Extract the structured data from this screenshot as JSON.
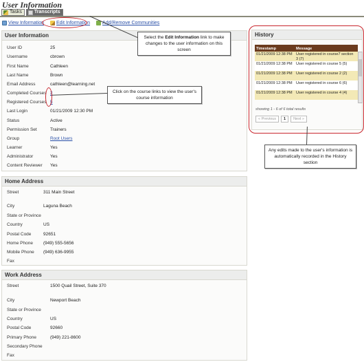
{
  "page": {
    "title": "User Information"
  },
  "tabs": [
    {
      "label": "Tasks"
    },
    {
      "label": "Transcripts"
    }
  ],
  "actions": {
    "view": "View Information",
    "edit": "Edit Information",
    "communities": "Add/Remove Communities"
  },
  "user_info": {
    "heading": "User Information",
    "rows": [
      {
        "label": "User ID",
        "value": "25"
      },
      {
        "label": "Username",
        "value": "cbrown"
      },
      {
        "label": "First Name",
        "value": "Cathleen"
      },
      {
        "label": "Last Name",
        "value": "Brown"
      },
      {
        "label": "Email Address",
        "value": "cathleen@learning.net"
      },
      {
        "label": "Completed Courses",
        "value": "2"
      },
      {
        "label": "Registered Courses",
        "value": "5"
      },
      {
        "label": "Last Login",
        "value": "01/21/2009 12:30 PM"
      },
      {
        "label": "Status",
        "value": "Active"
      },
      {
        "label": "Permission Set",
        "value": "Trainers"
      },
      {
        "label": "Group",
        "value": "Root Users"
      },
      {
        "label": "Learner",
        "value": "Yes"
      },
      {
        "label": "Administrator",
        "value": "Yes"
      },
      {
        "label": "Content Reviewer",
        "value": "Yes"
      }
    ]
  },
  "home_address": {
    "heading": "Home Address",
    "rows": [
      {
        "label": "Street",
        "value": "311 Main Street"
      },
      {
        "label": "City",
        "value": "Laguna Beach"
      },
      {
        "label": "State or Province",
        "value": ""
      },
      {
        "label": "Country",
        "value": "US"
      },
      {
        "label": "Postal Code",
        "value": "92651"
      },
      {
        "label": "Home Phone",
        "value": "(949) 555-5656"
      },
      {
        "label": "Mobile Phone",
        "value": "(949) 636-9955"
      },
      {
        "label": "Fax",
        "value": ""
      }
    ]
  },
  "work_address": {
    "heading": "Work Address",
    "rows": [
      {
        "label": "Street",
        "value": "1500 Quail Street, Suite 370"
      },
      {
        "label": "City",
        "value": "Newport Beach"
      },
      {
        "label": "State or Province",
        "value": ""
      },
      {
        "label": "Country",
        "value": "US"
      },
      {
        "label": "Postal Code",
        "value": "92660"
      },
      {
        "label": "Primary Phone",
        "value": "(949) 221-8600"
      },
      {
        "label": "Secondary Phone",
        "value": ""
      },
      {
        "label": "Fax",
        "value": ""
      }
    ]
  },
  "history": {
    "heading": "History",
    "columns": [
      "Timestamp",
      "Message"
    ],
    "rows": [
      {
        "timestamp": "01/21/2009 12:38 PM",
        "message": "User registered in course7 section 3 (7)"
      },
      {
        "timestamp": "01/21/2009 12:38 PM",
        "message": "User registered in course 5 (5)"
      },
      {
        "timestamp": "01/21/2009 12:38 PM",
        "message": "User registered in course 2 (2)"
      },
      {
        "timestamp": "01/21/2009 12:38 PM",
        "message": "User registered in course 6 (6)"
      },
      {
        "timestamp": "01/21/2009 12:38 PM",
        "message": "User registered in course 4 (4)"
      }
    ],
    "footer": "showing 1 - 6 of 6 total results",
    "pager": {
      "prev": "« Previous",
      "page": "1",
      "next": "Next »"
    }
  },
  "callouts": {
    "edit_pre": "Select the ",
    "edit_bold": "Edit Information",
    "edit_post": " link to make changes to the user information on this screen",
    "courses": "Click on the course links to view the user's course information",
    "history": "Any edits made to the user's information is automatically recorded in the History section"
  },
  "colors": {
    "link": "#2a50a8",
    "highlight": "#c8252c",
    "history_header": "#6b3b1e",
    "history_alt_row": "#f3e9b6"
  }
}
